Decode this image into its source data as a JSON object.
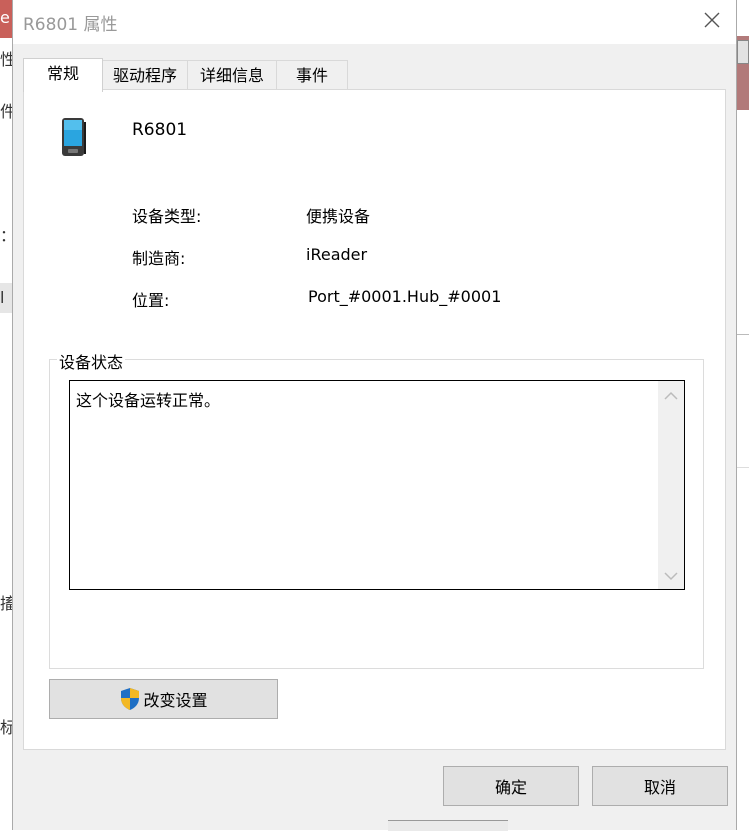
{
  "window": {
    "title": "R6801 属性"
  },
  "tabs": [
    {
      "label": "常规",
      "active": true
    },
    {
      "label": "驱动程序",
      "active": false
    },
    {
      "label": "详细信息",
      "active": false
    },
    {
      "label": "事件",
      "active": false
    }
  ],
  "device": {
    "name": "R6801",
    "icon": "portable-device-icon"
  },
  "properties": [
    {
      "label": "设备类型:",
      "value": "便携设备"
    },
    {
      "label": "制造商:",
      "value": "iReader"
    },
    {
      "label": "位置:",
      "value": "Port_#0001.Hub_#0001"
    }
  ],
  "status": {
    "group_label": "设备状态",
    "text": "这个设备运转正常。"
  },
  "buttons": {
    "change_settings": "改变设置",
    "ok": "确定",
    "cancel": "取消"
  },
  "background_fragments": {
    "left_letter": "e",
    "left_glyphs": [
      "性",
      "件",
      "：",
      "l",
      "搐",
      "标"
    ]
  },
  "colors": {
    "accent_shield_blue": "#1f6fc4",
    "accent_shield_yellow": "#f2b824",
    "background_window_red": "#c9605a"
  }
}
